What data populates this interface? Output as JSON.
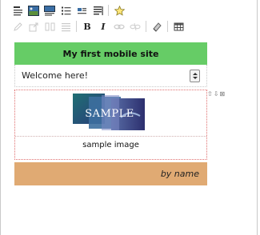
{
  "toolbar_top": {
    "buttons": [
      "heading-tool",
      "image-tool",
      "image-text-tool",
      "list-tool",
      "two-column-tool",
      "text-align-tool",
      "favorite-tool"
    ]
  },
  "toolbar_format": {
    "bold_label": "B",
    "italic_label": "I"
  },
  "site": {
    "title": "My first mobile site",
    "welcome_text": "Welcome here!",
    "image_watermark": "SAMPLE",
    "image_caption": "sample image",
    "footer_text": "by name"
  },
  "colors": {
    "title_bg": "#66cc66",
    "footer_bg": "#e0aa73",
    "selection_border": "#e07070"
  }
}
